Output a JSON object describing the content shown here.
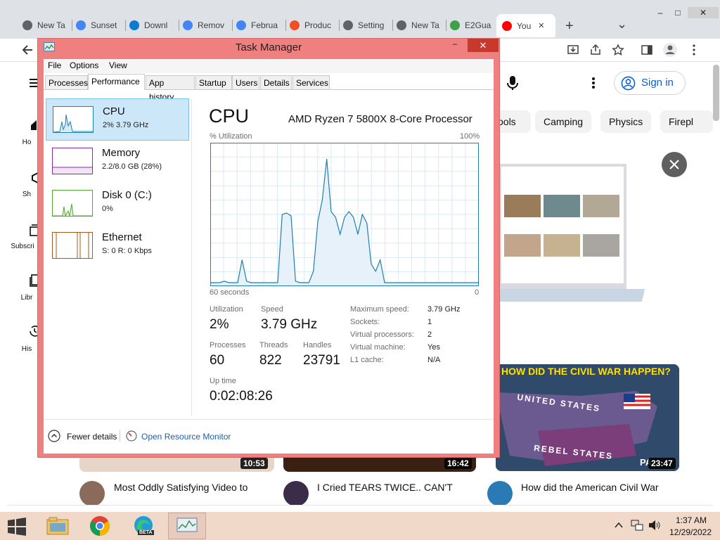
{
  "browser": {
    "tabs": [
      {
        "label": "New Ta",
        "icon": "chrome-icon",
        "color": "#5f6368"
      },
      {
        "label": "Sunset",
        "icon": "google-icon",
        "color": "#4285f4"
      },
      {
        "label": "Downl",
        "icon": "edge-icon",
        "color": "#0c7bd1"
      },
      {
        "label": "Remov",
        "icon": "google-icon",
        "color": "#4285f4"
      },
      {
        "label": "Februa",
        "icon": "google-icon",
        "color": "#4285f4"
      },
      {
        "label": "Produc",
        "icon": "microsoft-icon",
        "color": "#f25022"
      },
      {
        "label": "Setting",
        "icon": "gear-icon",
        "color": "#5f6368"
      },
      {
        "label": "New Ta",
        "icon": "chrome-icon",
        "color": "#5f6368"
      },
      {
        "label": "E2Gua",
        "icon": "e2guardian-icon",
        "color": "#3ca24a"
      },
      {
        "label": "You",
        "icon": "youtube-icon",
        "color": "#ff0000"
      }
    ],
    "new_tab_symbol": "+",
    "dropdown_symbol": "⌄",
    "window_minimize": "–",
    "window_maximize": "□",
    "window_close": "✕"
  },
  "youtube": {
    "sign_in": "Sign in",
    "chips": [
      "ools",
      "Camping",
      "Physics",
      "Firepl"
    ],
    "sidebar": [
      "Ho",
      "Sh",
      "Subscri",
      "Libr",
      "His"
    ],
    "durations": [
      "10:53",
      "16:42",
      "23:47"
    ],
    "video_titles": [
      "Most Oddly Satisfying Video to",
      "I Cried TEARS TWICE.. CAN'T",
      "How did the American Civil War"
    ],
    "thumbnail_text": {
      "headline": "HOW DID THE CIVIL WAR HAPPEN?",
      "united": "UNITED STATES",
      "rebel": "REBEL STATES",
      "corner": "PA"
    }
  },
  "task_manager": {
    "title": "Task Manager",
    "menu": [
      "File",
      "Options",
      "View"
    ],
    "tabs": [
      "Processes",
      "Performance",
      "App history",
      "Startup",
      "Users",
      "Details",
      "Services"
    ],
    "active_tab": "Performance",
    "resources": [
      {
        "name": "CPU",
        "detail": "2% 3.79 GHz",
        "color": "#1e80b0"
      },
      {
        "name": "Memory",
        "detail": "2.2/8.0 GB (28%)",
        "color": "#8b2aa6"
      },
      {
        "name": "Disk 0 (C:)",
        "detail": "0%",
        "color": "#4ea72c"
      },
      {
        "name": "Ethernet",
        "detail": "S: 0 R: 0 Kbps",
        "color": "#a9581a"
      }
    ],
    "header": "CPU",
    "processor": "AMD Ryzen 7 5800X 8-Core Processor",
    "graph_label_left": "% Utilization",
    "graph_label_right": "100%",
    "graph_bottom_left": "60 seconds",
    "graph_bottom_right": "0",
    "stats": {
      "utilization_label": "Utilization",
      "utilization": "2%",
      "speed_label": "Speed",
      "speed": "3.79 GHz",
      "processes_label": "Processes",
      "processes": "60",
      "threads_label": "Threads",
      "threads": "822",
      "handles_label": "Handles",
      "handles": "23791",
      "uptime_label": "Up time",
      "uptime": "0:02:08:26"
    },
    "specs": [
      {
        "label": "Maximum speed:",
        "value": "3.79 GHz"
      },
      {
        "label": "Sockets:",
        "value": "1"
      },
      {
        "label": "Virtual processors:",
        "value": "2"
      },
      {
        "label": "Virtual machine:",
        "value": "Yes"
      },
      {
        "label": "L1 cache:",
        "value": "N/A"
      }
    ],
    "fewer_details": "Fewer details",
    "open_resource_monitor": "Open Resource Monitor",
    "cpu_history": [
      2,
      2,
      2,
      3,
      2,
      2,
      2,
      18,
      3,
      2,
      2,
      2,
      2,
      2,
      2,
      2,
      50,
      51,
      49,
      3,
      2,
      2,
      2,
      10,
      45,
      60,
      89,
      52,
      48,
      36,
      48,
      52,
      48,
      36,
      50,
      44,
      15,
      10,
      18,
      2,
      2,
      2,
      2,
      2,
      2,
      2,
      2,
      2,
      2,
      2,
      2,
      2,
      2,
      2,
      2,
      2,
      2,
      2,
      2,
      2,
      2
    ]
  },
  "taskbar": {
    "time": "1:37 AM",
    "date": "12/29/2022",
    "edge_badge": "BETA"
  }
}
